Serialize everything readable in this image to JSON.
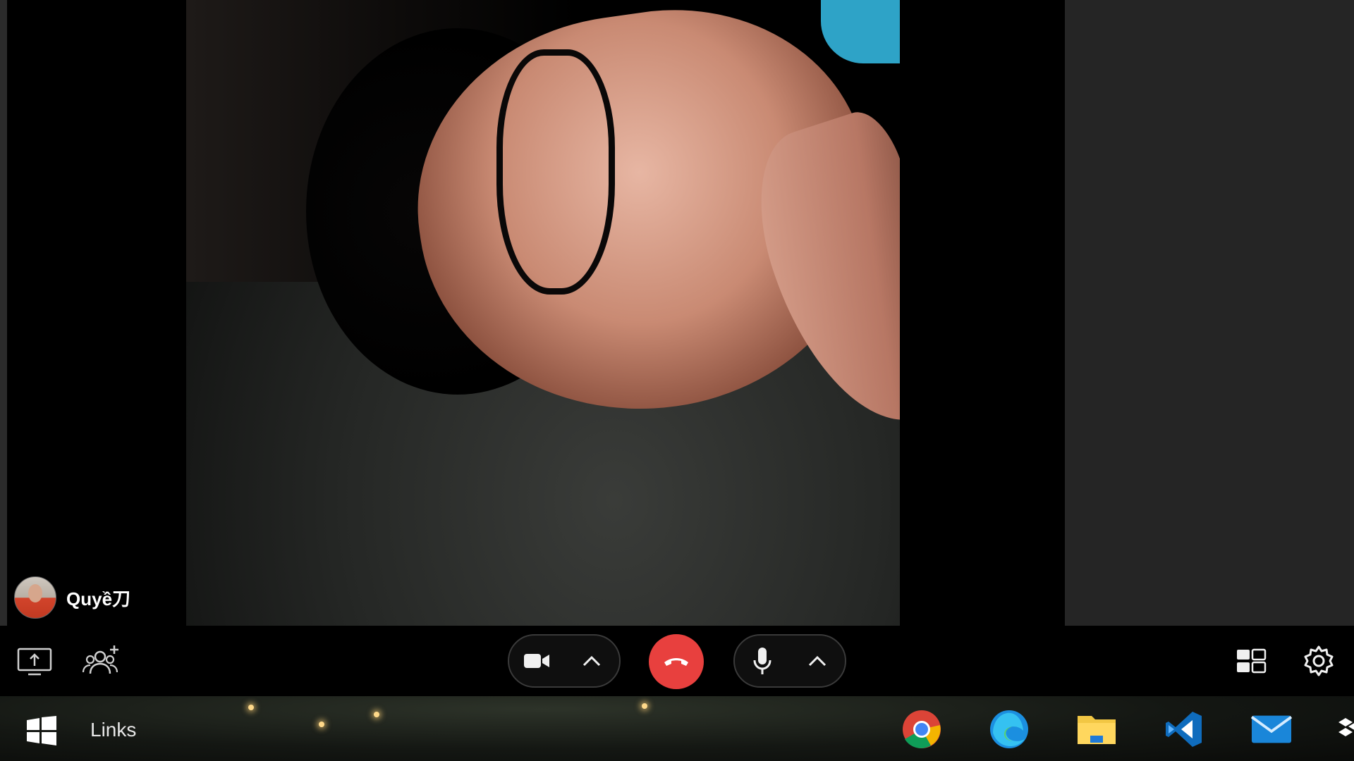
{
  "participant": {
    "name": "Quyề刀"
  },
  "controls": {
    "share_screen_icon": "share-screen-icon",
    "add_people_icon": "add-people-icon",
    "video_icon": "video-camera-icon",
    "mic_icon": "microphone-icon",
    "end_call_icon": "phone-hangup-icon",
    "layout_icon": "layout-grid-icon",
    "settings_icon": "gear-icon",
    "end_call_color": "#e8403e"
  },
  "taskbar": {
    "start_icon": "windows-icon",
    "links_label": "Links",
    "apps": [
      "chrome-icon",
      "edge-icon",
      "file-explorer-icon",
      "vscode-icon",
      "mail-icon",
      "dropbox-icon"
    ]
  }
}
